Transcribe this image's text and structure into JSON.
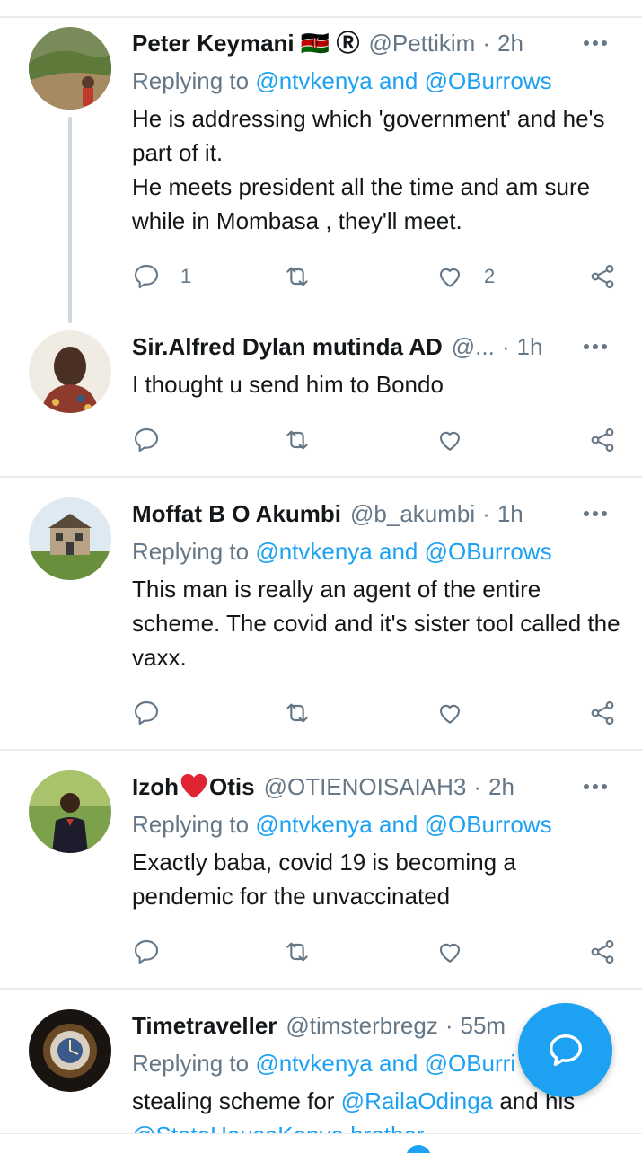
{
  "colors": {
    "accent": "#1da1f2",
    "secondary_text": "#657786",
    "divider": "#e6ecf0"
  },
  "tweets": [
    {
      "name": "Peter Keymani 🇰🇪 Ⓡ",
      "handle": "@Pettikim",
      "time": "2h",
      "reply_prefix": "Replying to",
      "reply_to": "@ntvkenya and @OBurrows",
      "body_lines": [
        "He is addressing which 'government' and he's part of it.",
        "He meets president all the time and am sure while in Mombasa , they'll meet."
      ],
      "reply_count": "1",
      "retweet_count": "",
      "like_count": "2"
    },
    {
      "name": "Sir.Alfred Dylan mutinda AD",
      "handle": "@...",
      "time": "1h",
      "body": "I thought u send him to Bondo",
      "reply_count": "",
      "retweet_count": "",
      "like_count": ""
    },
    {
      "name": "Moffat B O Akumbi",
      "handle": "@b_akumbi",
      "time": "1h",
      "reply_prefix": "Replying to",
      "reply_to": "@ntvkenya and @OBurrows",
      "body": "This man is really an agent of the entire scheme. The covid and it's sister tool called the vaxx.",
      "reply_count": "",
      "retweet_count": "",
      "like_count": ""
    },
    {
      "name_left": "Izoh",
      "name_right": "Otis",
      "handle": "@OTIENOISAIAH3",
      "time": "2h",
      "reply_prefix": "Replying to",
      "reply_to": "@ntvkenya and @OBurrows",
      "body": "Exactly baba, covid 19 is becoming a pendemic for the unvaccinated",
      "reply_count": "",
      "retweet_count": "",
      "like_count": ""
    },
    {
      "name": "Timetraveller",
      "handle": "@timsterbregz",
      "time": "55m",
      "reply_prefix": "Replying to",
      "reply_to": "@ntvkenya and @OBurri",
      "body_prefix": "stealing scheme for ",
      "body_mention": "@RailaOdinga",
      "body_suffix": " and his",
      "body_line2": "@StateHouseKenya brother"
    }
  ],
  "icons": {
    "reply": "reply-icon",
    "retweet": "retweet-icon",
    "like": "heart-icon",
    "share": "share-icon",
    "more": "more-icon",
    "compose": "compose-reply-icon"
  }
}
